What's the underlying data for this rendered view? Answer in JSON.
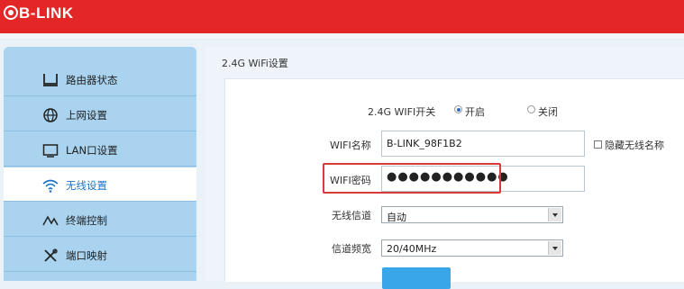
{
  "header": {
    "logo_text": "B-LINK",
    "brand_color": "#e32626"
  },
  "sidebar": {
    "items": [
      {
        "label": "路由器状态",
        "icon": "router-status-icon",
        "active": false
      },
      {
        "label": "上网设置",
        "icon": "globe-icon",
        "active": false
      },
      {
        "label": "LAN口设置",
        "icon": "monitor-icon",
        "active": false
      },
      {
        "label": "无线设置",
        "icon": "wifi-icon",
        "active": true
      },
      {
        "label": "终端控制",
        "icon": "activity-icon",
        "active": false
      },
      {
        "label": "端口映射",
        "icon": "tools-icon",
        "active": false
      }
    ]
  },
  "main": {
    "section_title": "2.4G WiFi设置",
    "wifi_switch": {
      "label": "2.4G WIFI开关",
      "on_label": "开启",
      "off_label": "关闭",
      "selected": "开启"
    },
    "ssid": {
      "label": "WIFI名称",
      "value": "B-LINK_98F1B2"
    },
    "hide_ssid": {
      "label": "隐藏无线名称",
      "checked": false
    },
    "password": {
      "label": "WIFI密码",
      "masked": "●●●●●●●●●●●"
    },
    "channel": {
      "label": "无线信道",
      "value": "自动"
    },
    "bandwidth": {
      "label": "信道频宽",
      "value": "20/40MHz"
    },
    "accent_color": "#38a6e8",
    "highlight_color": "#d83a3a"
  }
}
